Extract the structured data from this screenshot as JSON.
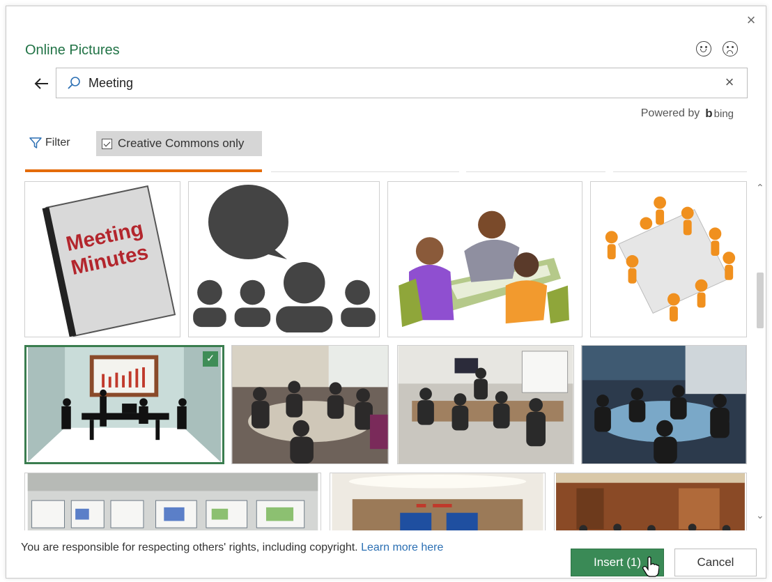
{
  "dialog": {
    "title": "Online Pictures",
    "close_icon": "close-icon"
  },
  "search": {
    "value": "Meeting",
    "placeholder": "Search Bing"
  },
  "powered_by": {
    "label": "Powered by",
    "brand": "bing"
  },
  "filters": {
    "filter_label": "Filter",
    "creative_commons_label": "Creative Commons only",
    "creative_commons_checked": true
  },
  "results": [
    {
      "id": "meeting-minutes",
      "text_line1": "Meeting",
      "text_line2": "Minutes",
      "selected": false
    },
    {
      "id": "speech-bubble-people",
      "selected": false
    },
    {
      "id": "cartoon-team",
      "selected": false
    },
    {
      "id": "orange-figures-table",
      "selected": false
    },
    {
      "id": "silhouette-presentation",
      "selected": true
    },
    {
      "id": "photo-meeting-1",
      "selected": false
    },
    {
      "id": "photo-meeting-2",
      "selected": false
    },
    {
      "id": "photo-meeting-3",
      "selected": false
    },
    {
      "id": "photo-maps-room",
      "selected": false
    },
    {
      "id": "photo-conference-room",
      "selected": false
    },
    {
      "id": "photo-boardroom",
      "selected": false
    }
  ],
  "footer": {
    "notice": "You are responsible for respecting others' rights, including copyright.",
    "learn_more": "Learn more here",
    "insert_label": "Insert (1)",
    "cancel_label": "Cancel"
  },
  "colors": {
    "accent_green": "#217346",
    "button_green": "#3a8a56",
    "link_blue": "#2b6fb3",
    "tab_orange": "#e46c0a"
  }
}
